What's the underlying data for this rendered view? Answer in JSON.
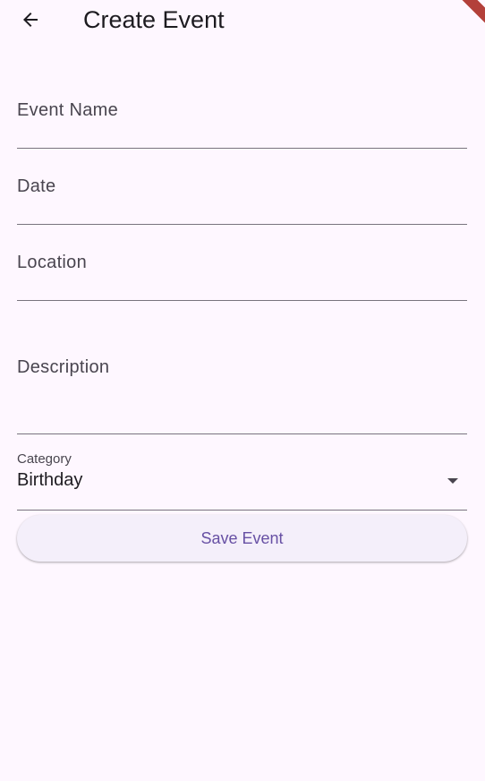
{
  "app_bar": {
    "title": "Create Event",
    "back_icon": "arrow-back-icon"
  },
  "form": {
    "event_name": {
      "label": "Event Name",
      "value": ""
    },
    "date": {
      "label": "Date",
      "value": ""
    },
    "location": {
      "label": "Location",
      "value": ""
    },
    "description": {
      "label": "Description",
      "value": ""
    },
    "category": {
      "label": "Category",
      "selected": "Birthday"
    },
    "save_label": "Save Event"
  },
  "colors": {
    "background": "#fef7ff",
    "primary": "#6750a4",
    "outline": "#79747e",
    "button_surface": "#f4effa",
    "debug_banner": "#b3403a"
  }
}
